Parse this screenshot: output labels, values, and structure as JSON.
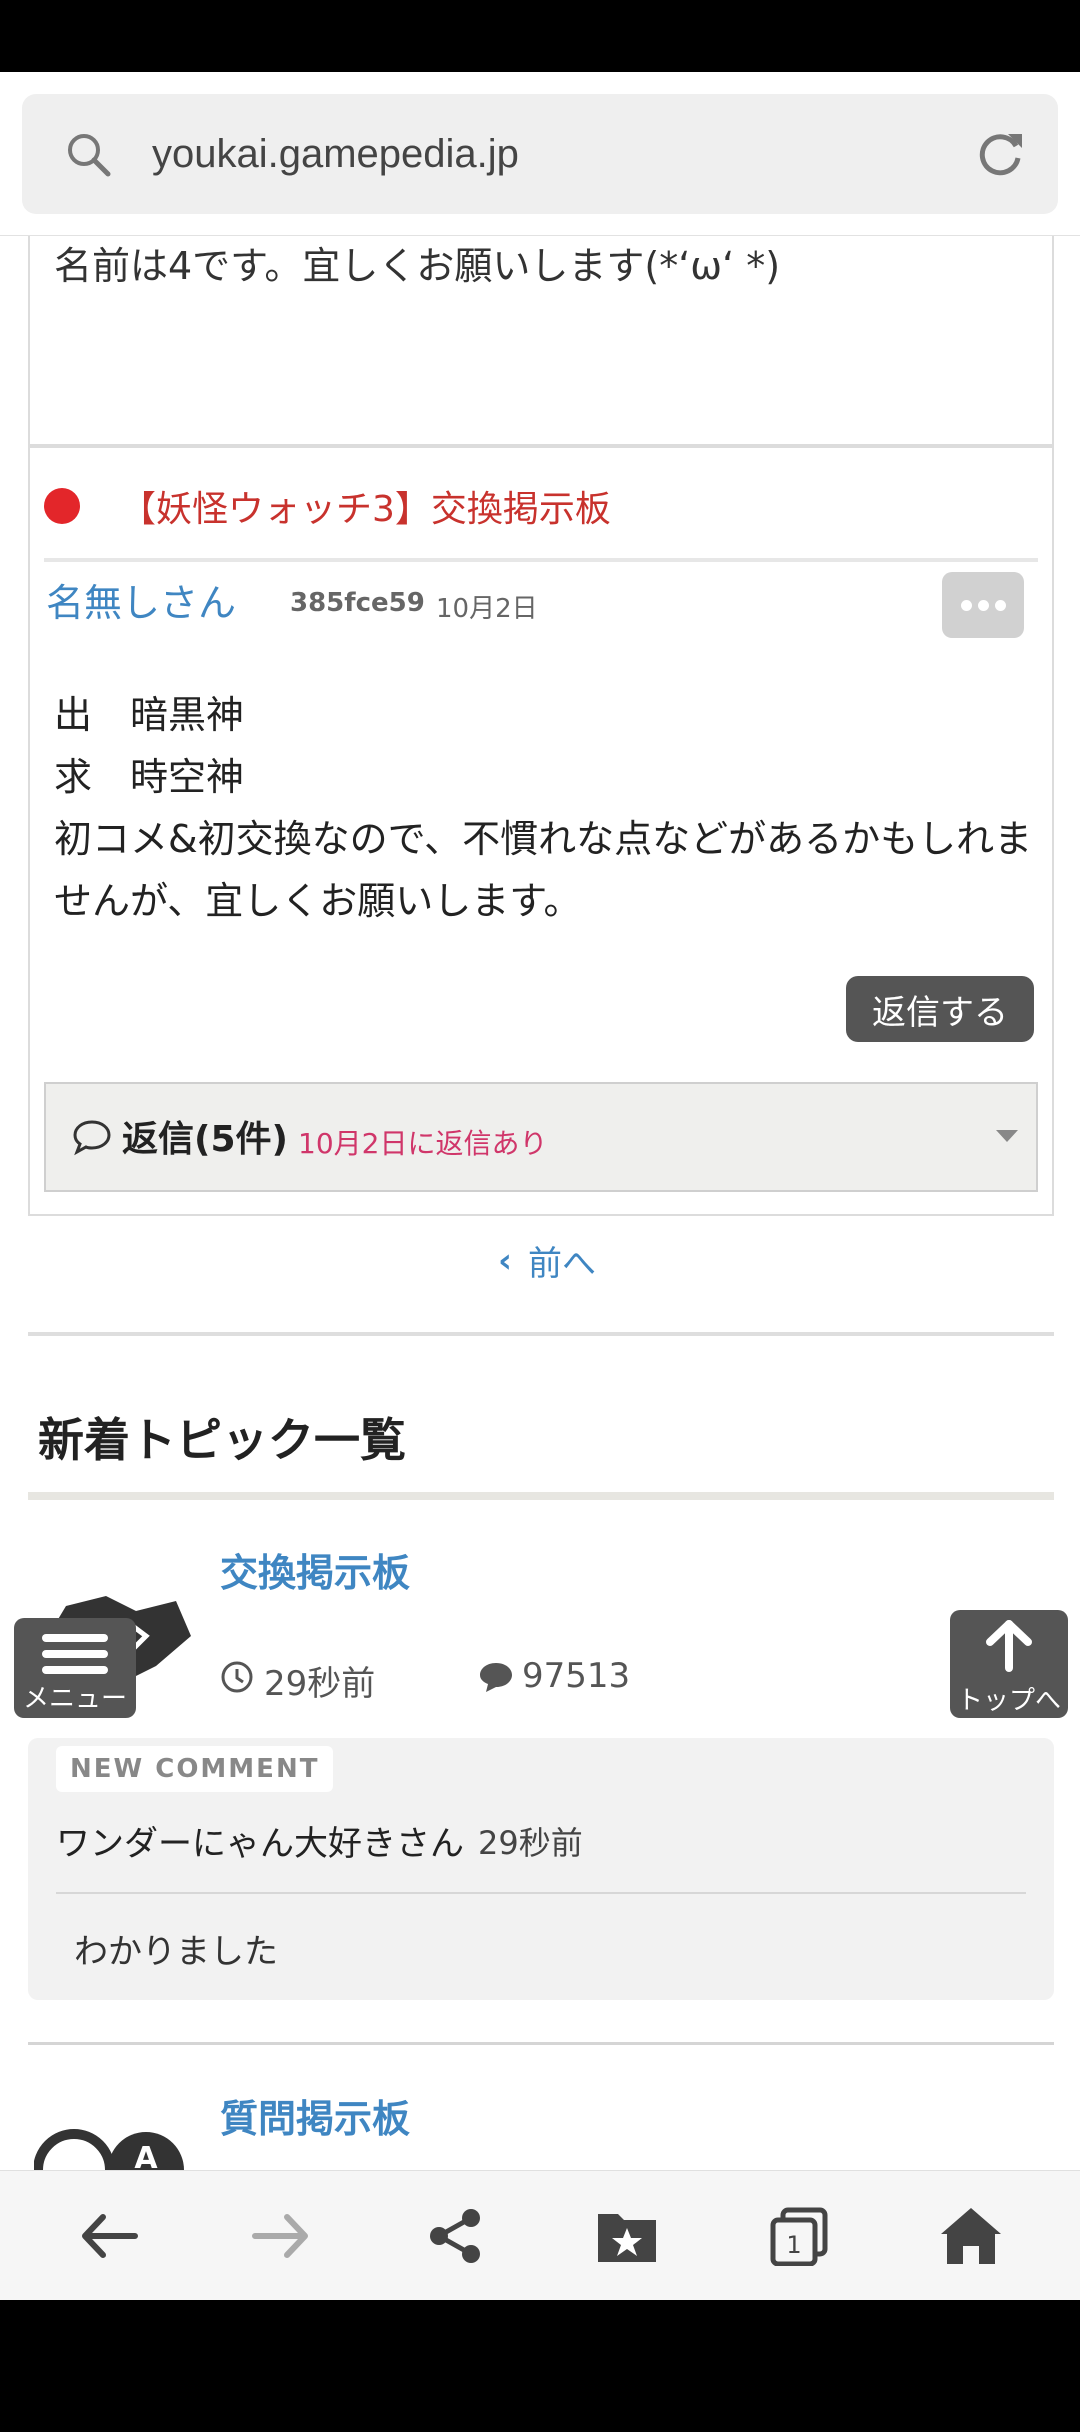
{
  "browser": {
    "url": "youkai.gamepedia.jp",
    "tab_count": "1"
  },
  "post": {
    "intro_text": "名前は4です。宜しくお願いします(*‘ω‘ *)"
  },
  "topic": {
    "board_title": "【妖怪ウォッチ3】交換掲示板",
    "author": "名無しさん",
    "hash": "385fce59",
    "date": "10月2日",
    "body_line1": "出　暗黒神",
    "body_line2": "求　時空神",
    "body_line3": "初コメ&初交換なので、不慣れな点などがあるかもしれませんが、宜しくお願いします。",
    "reply_button": "返信する",
    "replies_label": "返信(5件)",
    "replies_time": "10月2日に返信あり"
  },
  "nav": {
    "prev_label": "前へ"
  },
  "new_topics": {
    "section_title": "新着トピック一覧",
    "items": [
      {
        "name": "交換掲示板",
        "age": "29秒前",
        "count": "97513",
        "badge": "NEW COMMENT",
        "comment_author": "ワンダーにゃん大好きさん",
        "comment_time": "29秒前",
        "comment_text": "わかりました"
      },
      {
        "name": "質問掲示板"
      }
    ]
  },
  "floating": {
    "menu_label": "メニュー",
    "top_label": "トップへ"
  },
  "colors": {
    "link_blue": "#3f86c2",
    "board_red": "#c8322d",
    "reply_pink": "#d0366a"
  }
}
